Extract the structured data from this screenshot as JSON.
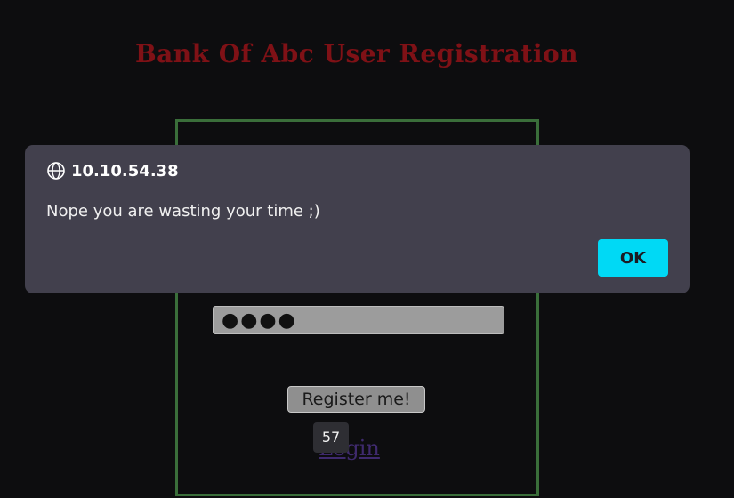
{
  "page": {
    "title": "Bank Of Abc User Registration",
    "password_mask": "●●●●",
    "register_label": "Register me!",
    "login_label": "Login",
    "tooltip_value": "57"
  },
  "alert": {
    "origin": "10.10.54.38",
    "message": "Nope you are wasting your time ;)",
    "ok_label": "OK"
  },
  "colors": {
    "background": "#0d0d0f",
    "title": "#7f1116",
    "box_border": "#3a6e3a",
    "dialog": "#42404d",
    "ok_button": "#00d9f5"
  },
  "icons": {
    "origin": "globe-icon"
  }
}
